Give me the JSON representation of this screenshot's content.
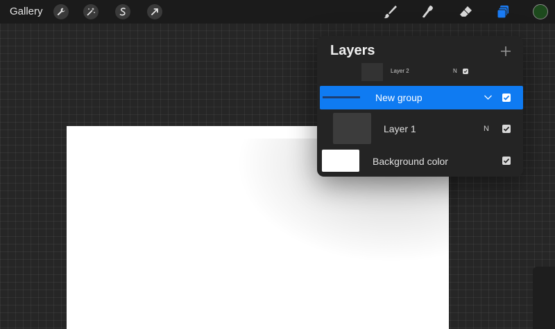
{
  "topbar": {
    "gallery_label": "Gallery",
    "left_tools": [
      "wrench-icon",
      "magic-wand-icon",
      "selection-s-icon",
      "transform-arrow-icon"
    ],
    "right_tools": [
      "brush-icon",
      "smudge-icon",
      "eraser-icon",
      "layers-icon"
    ],
    "layers_icon_color": "#1a7cf5",
    "current_color": "#1d4a1d"
  },
  "layers_panel": {
    "title": "Layers",
    "add_icon": "plus-icon",
    "rows": [
      {
        "label": "Layer 2",
        "blend": "N",
        "visible": true
      },
      {
        "label": "New group",
        "selected": true,
        "visible": true,
        "expanded": true
      },
      {
        "label": "Layer 1",
        "blend": "N",
        "visible": true
      },
      {
        "label": "Background color",
        "visible": true
      }
    ],
    "accent": "#0f7bf2"
  },
  "canvas": {
    "background": "#ffffff"
  }
}
